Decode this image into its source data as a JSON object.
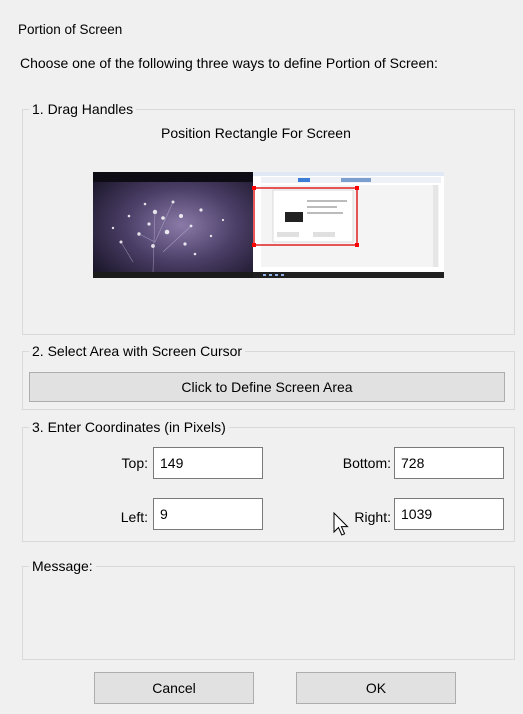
{
  "window": {
    "title": "Portion of Screen",
    "instruction": "Choose one of the following three ways to define Portion of Screen:"
  },
  "drag_handles": {
    "legend": "1. Drag Handles",
    "heading": "Position Rectangle For Screen"
  },
  "select_area": {
    "legend": "2. Select Area with Screen Cursor",
    "button_label": "Click to Define Screen Area"
  },
  "coordinates": {
    "legend": "3. Enter Coordinates (in Pixels)",
    "top_label": "Top:",
    "top_value": "149",
    "bottom_label": "Bottom:",
    "bottom_value": "728",
    "left_label": "Left:",
    "left_value": "9",
    "right_label": "Right:",
    "right_value": "1039"
  },
  "message": {
    "legend": "Message:",
    "text": ""
  },
  "footer": {
    "cancel_label": "Cancel",
    "ok_label": "OK"
  },
  "colors": {
    "selection_rect": "#e02020",
    "handle": "#ff0000"
  }
}
